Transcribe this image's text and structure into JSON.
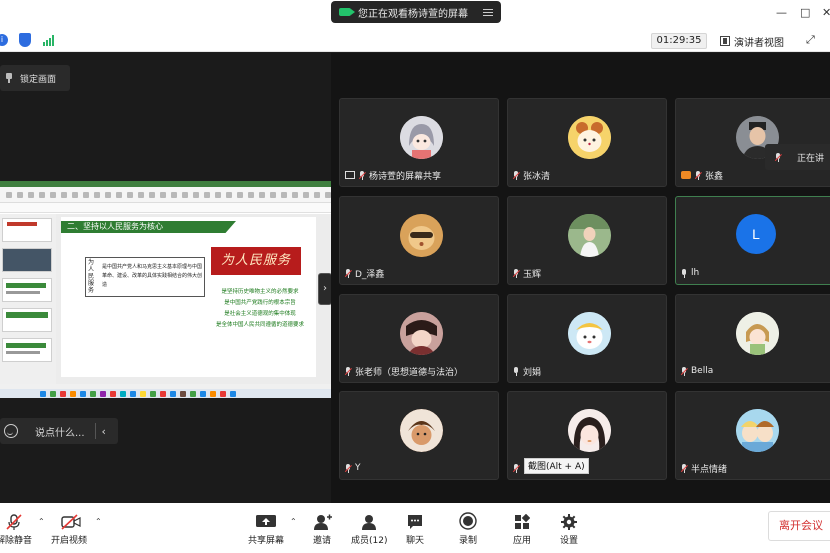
{
  "titlebar": {
    "banner_text": "您正在观看杨诗萱的屏幕"
  },
  "toolbar": {
    "timer": "01:29:35",
    "view_label": "演讲者视图"
  },
  "share": {
    "lock_label": "锁定画面",
    "chat_placeholder": "说点什么...",
    "slide": {
      "heading": "二、坚持以人民服务为核心",
      "vertical_label": "为人民服务",
      "paragraph": "是中国共产党人和马克思主义基本原理与中国革命、建设、改革的具体实践相结合的伟大创造",
      "banner_title": "为人民服务",
      "lines": [
        "是坚持历史唯物主义的必然要求",
        "是中国共产党践行的根本宗旨",
        "是社会主义道德观的集中体现",
        "是全体中国人民共同遵循的道德要求"
      ]
    }
  },
  "gallery": {
    "speaking_label": "正在讲",
    "tiles": [
      {
        "name": "杨诗萱的屏幕共享",
        "icon": "screen-share-icon"
      },
      {
        "name": "张冰清",
        "icon": "mic-muted-icon"
      },
      {
        "name": "张鑫",
        "icon": "camera-off-icon"
      },
      {
        "name": "D_泽鑫",
        "icon": "mic-muted-icon"
      },
      {
        "name": "玉辉",
        "icon": "mic-muted-icon"
      },
      {
        "name": "lh",
        "icon": "mic-icon",
        "initial": "L"
      },
      {
        "name": "张老师（思想道德与法治）",
        "icon": "mic-muted-icon"
      },
      {
        "name": "刘娟",
        "icon": "mic-icon"
      },
      {
        "name": "Bella",
        "icon": "mic-muted-icon"
      },
      {
        "name": "Y",
        "icon": "mic-muted-icon"
      },
      {
        "name": "",
        "icon": "mic-muted-icon"
      },
      {
        "name": "半点情绪",
        "icon": "mic-muted-icon"
      }
    ],
    "tooltip": "截图(Alt + A)"
  },
  "bottom": {
    "unmute": "解除静音",
    "start_video": "开启视频",
    "share_screen": "共享屏幕",
    "invite": "邀请",
    "members": "成员(12)",
    "chat": "聊天",
    "record": "录制",
    "apps": "应用",
    "settings": "设置",
    "leave": "离开会议"
  },
  "colors": {
    "accent_green": "#2f7d32",
    "leave_red": "#d32f2f",
    "avatar_blue": "#1a73e8"
  }
}
